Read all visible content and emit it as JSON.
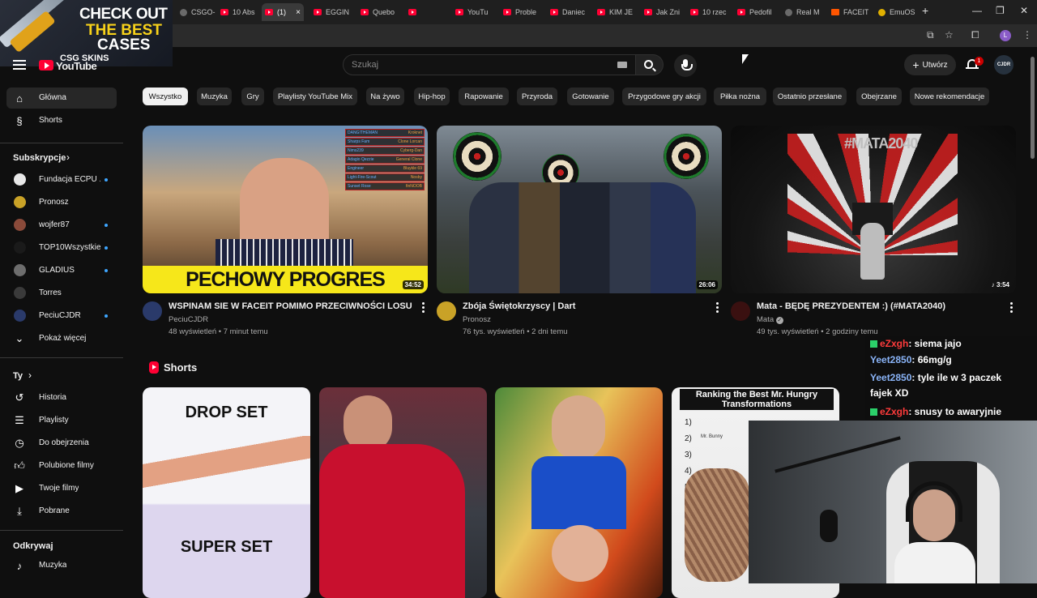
{
  "browser": {
    "tabs": [
      {
        "label": "CSGO-",
        "icon": "favicon-generic"
      },
      {
        "label": "10 Abs",
        "icon": "youtube-favicon"
      },
      {
        "label": "(1)",
        "icon": "youtube-favicon",
        "active": true
      },
      {
        "label": "EGGIN",
        "icon": "youtube-favicon"
      },
      {
        "label": "Quebo",
        "icon": "youtube-favicon"
      },
      {
        "label": "",
        "icon": "youtube-favicon"
      },
      {
        "label": "YouTu",
        "icon": "youtube-favicon"
      },
      {
        "label": "Proble",
        "icon": "youtube-favicon"
      },
      {
        "label": "Daniec",
        "icon": "youtube-favicon"
      },
      {
        "label": "KIM JE",
        "icon": "youtube-favicon"
      },
      {
        "label": "Jak Zni",
        "icon": "youtube-favicon"
      },
      {
        "label": "10 rzec",
        "icon": "youtube-favicon"
      },
      {
        "label": "Pedofil",
        "icon": "youtube-favicon"
      },
      {
        "label": "Real M",
        "icon": "favicon-generic"
      },
      {
        "label": "FACEIT",
        "icon": "faceit-favicon"
      },
      {
        "label": "EmuOS",
        "icon": "emuos-favicon"
      }
    ],
    "tab_close": "×",
    "new_tab": "+",
    "window_controls": [
      "—",
      "❐",
      "✕"
    ],
    "profile_letter": "L",
    "toolbar_icons": [
      "cast-icon",
      "star-icon",
      "extensions-icon",
      "profile-icon",
      "more-icon"
    ]
  },
  "ad": {
    "line1": "CHECK OUT",
    "line2": "THE BEST",
    "line3": "CASES",
    "brand": "CSG SKINS"
  },
  "header": {
    "logo_text": "YouTube",
    "search_placeholder": "Szukaj",
    "create_label": "Utwórz",
    "notification_count": "1",
    "avatar_text": "CJDR"
  },
  "chips": [
    "Wszystko",
    "Muzyka",
    "Gry",
    "Playlisty YouTube Mix",
    "Na żywo",
    "Hip-hop",
    "Rapowanie",
    "Przyroda",
    "Gotowanie",
    "Przygodowe gry akcji",
    "Piłka nożna",
    "Ostatnio przesłane",
    "Obejrzane",
    "Nowe rekomendacje"
  ],
  "sidebar": {
    "main": [
      {
        "label": "Główna",
        "icon": "home-icon",
        "active": true
      },
      {
        "label": "Shorts",
        "icon": "shorts-icon"
      }
    ],
    "subs_header": "Subskrypcje",
    "subs": [
      {
        "label": "Fundacja ECPU ...",
        "color": "#e8e8e8",
        "dot": true
      },
      {
        "label": "Pronosz",
        "color": "#c9a227",
        "dot": false
      },
      {
        "label": "wojfer87",
        "color": "#8a4a3a",
        "dot": true
      },
      {
        "label": "TOP10Wszystkie...",
        "color": "#1a1a1a",
        "dot": true
      },
      {
        "label": "GLADIUS",
        "color": "#6d6d6d",
        "dot": true
      },
      {
        "label": "Torres",
        "color": "#3a3a3a",
        "dot": false
      },
      {
        "label": "PeciuCJDR",
        "color": "#2a3a6a",
        "dot": true
      }
    ],
    "show_more": "Pokaż więcej",
    "you_header": "Ty",
    "you": [
      {
        "label": "Historia",
        "icon": "history-icon"
      },
      {
        "label": "Playlisty",
        "icon": "playlist-icon"
      },
      {
        "label": "Do obejrzenia",
        "icon": "clock-icon"
      },
      {
        "label": "Polubione filmy",
        "icon": "thumbs-up-icon"
      },
      {
        "label": "Twoje filmy",
        "icon": "video-icon"
      },
      {
        "label": "Pobrane",
        "icon": "download-icon"
      }
    ],
    "explore_header": "Odkrywaj",
    "explore": [
      {
        "label": "Muzyka",
        "icon": "music-icon"
      }
    ]
  },
  "videos": [
    {
      "title": "WSPINAM SIE W FACEIT POMIMO PRZECIWNOŚCI LOSU",
      "channel": "PeciuCJDR",
      "meta": "48 wyświetleń • 7 minut temu",
      "duration": "34:52",
      "thumb_text": "PECHOWY PROGRES",
      "killfeed": [
        "DANGITHEMAN",
        "Kroknet",
        "Sharps Fam",
        "Clone Lorcan",
        "Nims239",
        "Cyberg-Dan",
        "Adagio Qezzie",
        "General Clone",
        "Engineer",
        "Bluykle 69",
        "Light-Fire-Scout",
        "Nosby",
        "Sunset Rose",
        "finNOOB"
      ],
      "avatar_color": "#2a3a6a"
    },
    {
      "title": "Zbója Świętokrzyscy | Dart",
      "channel": "Pronosz",
      "meta": "76 tys. wyświetleń • 2 dni temu",
      "duration": "26:06",
      "avatar_color": "#c9a227"
    },
    {
      "title": "Mata - BĘDĘ PREZYDENTEM :) (#MATA2040)",
      "channel": "Mata",
      "meta": "49 tys. wyświetleń • 2 godziny temu",
      "duration": "3:54",
      "thumb_text": "#MATA2040",
      "avatar_color": "#3a1010",
      "verified_icon": "verified-icon"
    }
  ],
  "shorts": {
    "title": "Shorts",
    "items": [
      {
        "top_text": "DROP SET",
        "bottom_text": "SUPER SET"
      },
      {
        "top_text": "",
        "bottom_text": ""
      },
      {
        "top_text": "",
        "bottom_text": ""
      },
      {
        "top_text": "Ranking the Best Mr. Hungry Transformations",
        "list": [
          "1)",
          "2)",
          "3)",
          "4)",
          "5)"
        ],
        "bunny": "Mr. Bunny"
      }
    ]
  },
  "chat": [
    {
      "user": "eZxgh",
      "msg": ": siema jajo",
      "red": true,
      "badge": true
    },
    {
      "user": "Yeet2850",
      "msg": ": 66mg/g",
      "red": false,
      "badge": false
    },
    {
      "user": "Yeet2850",
      "msg": ": tyle ile w 3 paczek",
      "red": false,
      "badge": false
    },
    {
      "user": "",
      "msg": "fajek XD",
      "red": false,
      "badge": false
    },
    {
      "user": "eZxgh",
      "msg": ": snusy to awaryjnie",
      "red": true,
      "badge": true
    }
  ]
}
